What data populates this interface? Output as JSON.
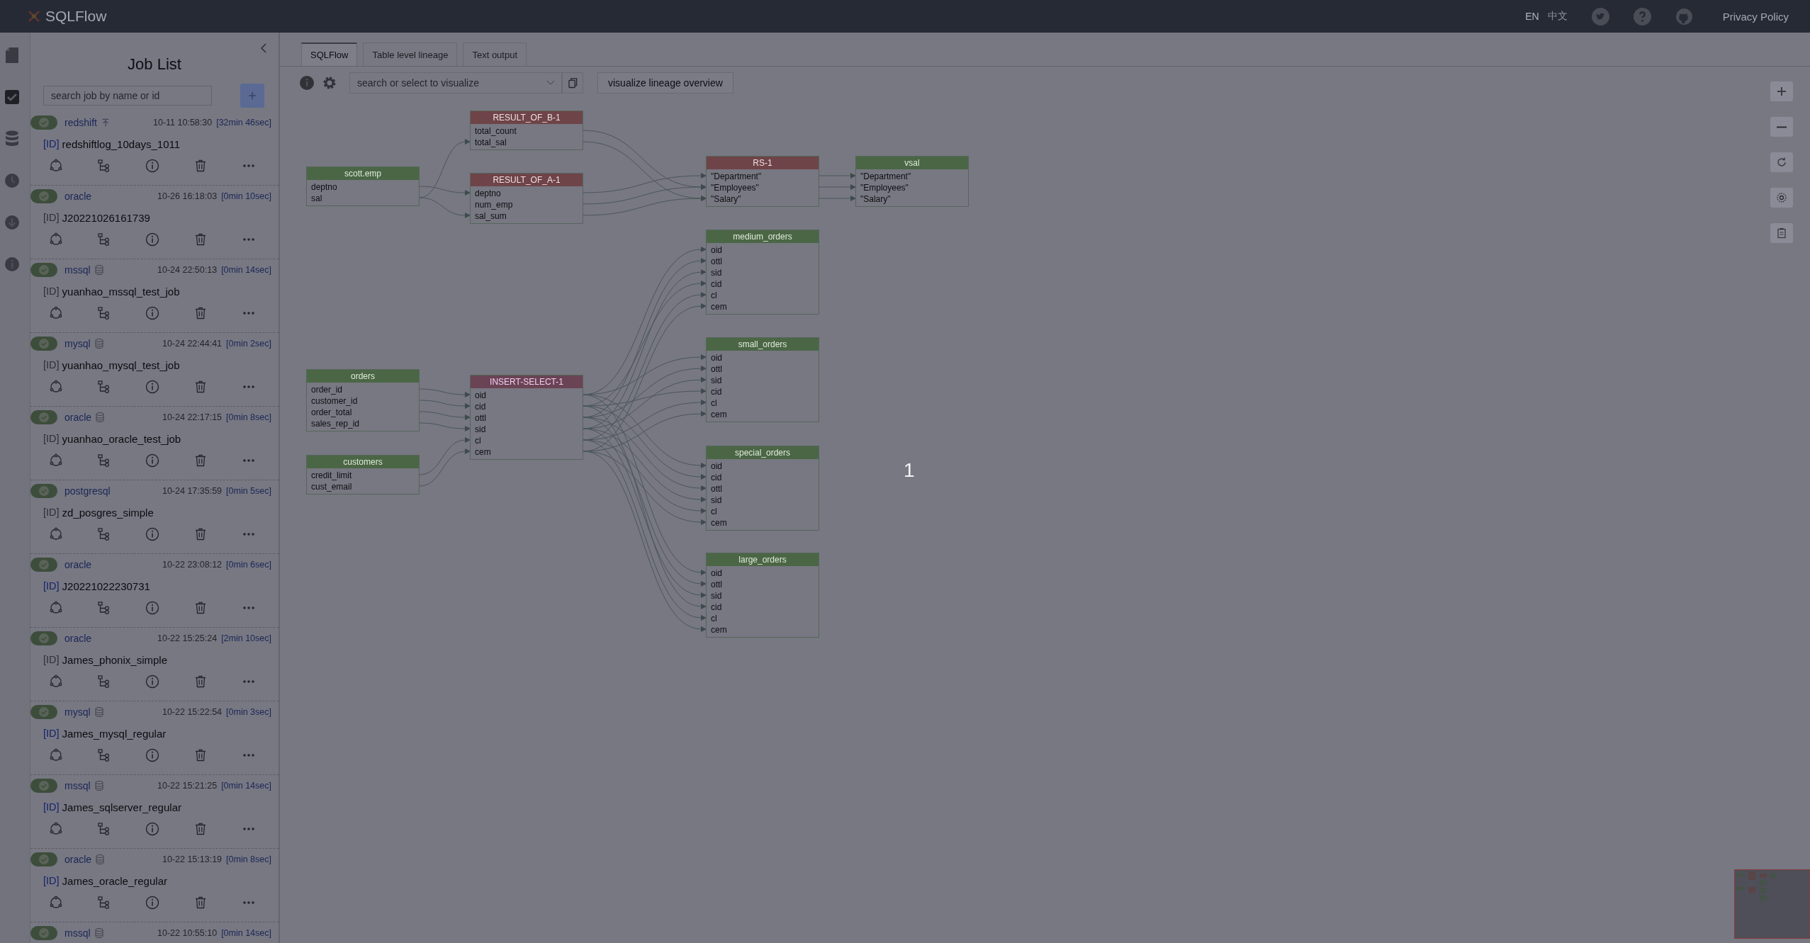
{
  "header": {
    "brand": "SQLFlow",
    "languages": [
      {
        "label": "EN",
        "selected": true
      },
      {
        "label": "中文",
        "selected": false
      }
    ],
    "privacy_link": "Privacy Policy"
  },
  "sidebar": {
    "title": "Job List",
    "search": {
      "placeholder": "search job by name or id"
    },
    "jobs": [
      {
        "db": "redshift",
        "kind": "pinned",
        "time": "10-11 10:58:30",
        "duration": "[32min 46sec]",
        "id_label": "[ID]",
        "name": "redshiftlog_10days_1011",
        "highlighted": true
      },
      {
        "db": "oracle",
        "kind": "plain",
        "time": "10-26 16:18:03",
        "duration": "[0min 10sec]",
        "id_label": "[ID]",
        "name": "J20221026161739",
        "highlighted": false
      },
      {
        "db": "mssql",
        "kind": "database",
        "time": "10-24 22:50:13",
        "duration": "[0min 14sec]",
        "id_label": "[ID]",
        "name": "yuanhao_mssql_test_job",
        "highlighted": false
      },
      {
        "db": "mysql",
        "kind": "database",
        "time": "10-24 22:44:41",
        "duration": "[0min 2sec]",
        "id_label": "[ID]",
        "name": "yuanhao_mysql_test_job",
        "highlighted": false
      },
      {
        "db": "oracle",
        "kind": "database",
        "time": "10-24 22:17:15",
        "duration": "[0min 8sec]",
        "id_label": "[ID]",
        "name": "yuanhao_oracle_test_job",
        "highlighted": false
      },
      {
        "db": "postgresql",
        "kind": "plain",
        "time": "10-24 17:35:59",
        "duration": "[0min 5sec]",
        "id_label": "[ID]",
        "name": "zd_posgres_simple",
        "highlighted": false
      },
      {
        "db": "oracle",
        "kind": "plain",
        "time": "10-22 23:08:12",
        "duration": "[0min 6sec]",
        "id_label": "[ID]",
        "name": "J20221022230731",
        "highlighted": true
      },
      {
        "db": "oracle",
        "kind": "plain",
        "time": "10-22 15:25:24",
        "duration": "[2min 10sec]",
        "id_label": "[ID]",
        "name": "James_phonix_simple",
        "highlighted": false
      },
      {
        "db": "mysql",
        "kind": "database",
        "time": "10-22 15:22:54",
        "duration": "[0min 3sec]",
        "id_label": "[ID]",
        "name": "James_mysql_regular",
        "highlighted": true
      },
      {
        "db": "mssql",
        "kind": "database",
        "time": "10-22 15:21:25",
        "duration": "[0min 14sec]",
        "id_label": "[ID]",
        "name": "James_sqlserver_regular",
        "highlighted": true
      },
      {
        "db": "oracle",
        "kind": "database",
        "time": "10-22 15:13:19",
        "duration": "[0min 8sec]",
        "id_label": "[ID]",
        "name": "James_oracle_regular",
        "highlighted": true
      },
      {
        "db": "mssql",
        "kind": "database",
        "time": "10-22 10:55:10",
        "duration": "[0min 14sec]"
      }
    ]
  },
  "tabs": [
    {
      "label": "SQLFlow",
      "selected": true
    },
    {
      "label": "Table level lineage",
      "selected": false
    },
    {
      "label": "Text output",
      "selected": false
    }
  ],
  "toolbar": {
    "search": {
      "placeholder": "search or select to visualize"
    },
    "overview_button": "visualize lineage overview"
  },
  "nodes": [
    {
      "kind": "table",
      "title": "scott.emp",
      "columns": [
        "deptno",
        "sal"
      ]
    },
    {
      "kind": "resultset",
      "title": "RESULT_OF_B-1",
      "columns": [
        "total_count",
        "total_sal"
      ]
    },
    {
      "kind": "resultset",
      "title": "RESULT_OF_A-1",
      "columns": [
        "deptno",
        "num_emp",
        "sal_sum"
      ]
    },
    {
      "kind": "resultset",
      "title": "RS-1",
      "columns": [
        "\"Department\"",
        "\"Employees\"",
        "\"Salary\""
      ]
    },
    {
      "kind": "table",
      "title": "vsal",
      "columns": [
        "\"Department\"",
        "\"Employees\"",
        "\"Salary\""
      ]
    },
    {
      "kind": "table",
      "title": "orders",
      "columns": [
        "order_id",
        "customer_id",
        "order_total",
        "sales_rep_id"
      ]
    },
    {
      "kind": "table",
      "title": "customers",
      "columns": [
        "credit_limit",
        "cust_email"
      ]
    },
    {
      "kind": "insert",
      "title": "INSERT-SELECT-1",
      "columns": [
        "oid",
        "cid",
        "ottl",
        "sid",
        "cl",
        "cem"
      ]
    },
    {
      "kind": "table",
      "title": "medium_orders",
      "columns": [
        "oid",
        "ottl",
        "sid",
        "cid",
        "cl",
        "cem"
      ]
    },
    {
      "kind": "table",
      "title": "small_orders",
      "columns": [
        "oid",
        "ottl",
        "sid",
        "cid",
        "cl",
        "cem"
      ]
    },
    {
      "kind": "table",
      "title": "special_orders",
      "columns": [
        "oid",
        "cid",
        "ottl",
        "sid",
        "cl",
        "cem"
      ]
    },
    {
      "kind": "table",
      "title": "large_orders",
      "columns": [
        "oid",
        "ottl",
        "sid",
        "cid",
        "cl",
        "cem"
      ]
    }
  ],
  "step_marker": "1"
}
